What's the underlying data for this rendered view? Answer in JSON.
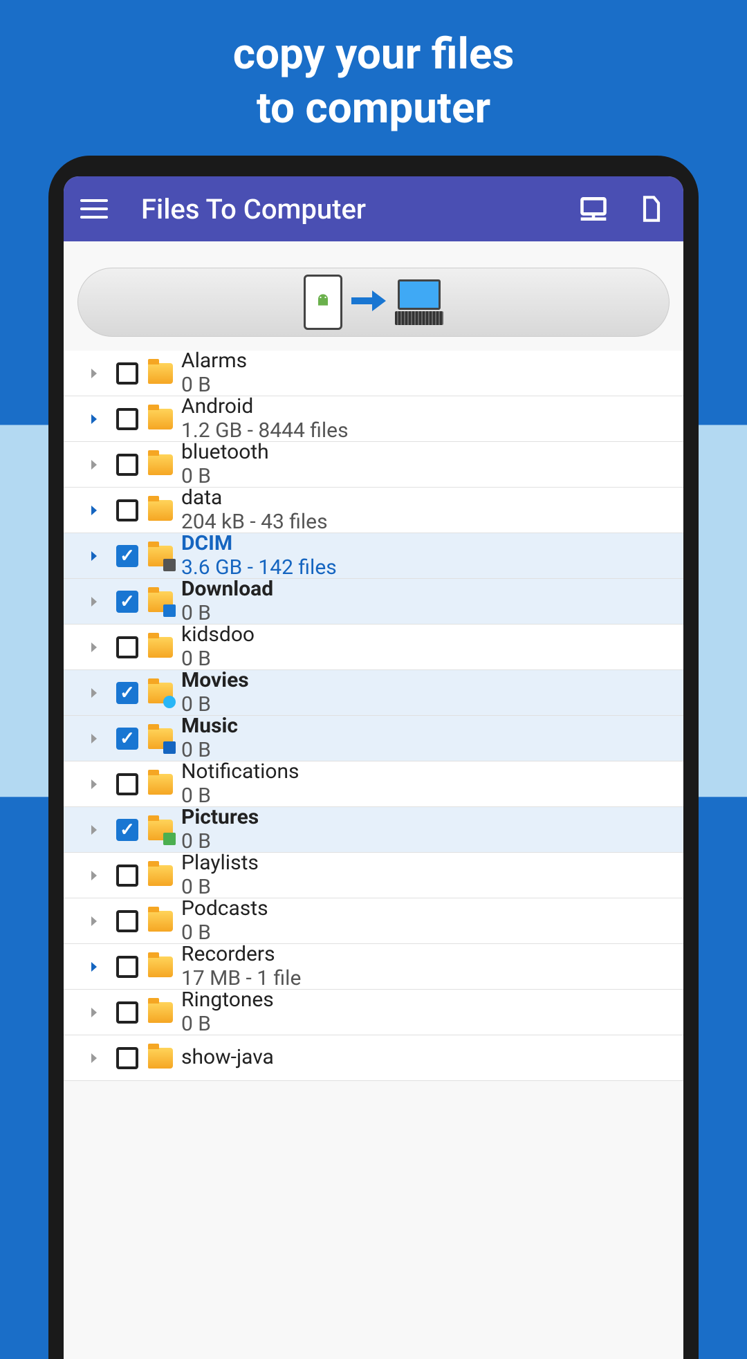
{
  "promo": {
    "line1": "copy your files",
    "line2": "to computer"
  },
  "appbar": {
    "title": "Files To Computer"
  },
  "items": [
    {
      "name": "Alarms",
      "sub": "0 B",
      "checked": false,
      "expandable": "gray",
      "icon": "plain",
      "bold": false,
      "active": false
    },
    {
      "name": "Android",
      "sub": "1.2 GB - 8444 files",
      "checked": false,
      "expandable": "blue",
      "icon": "plain",
      "bold": false,
      "active": false
    },
    {
      "name": "bluetooth",
      "sub": "0 B",
      "checked": false,
      "expandable": "gray",
      "icon": "plain",
      "bold": false,
      "active": false
    },
    {
      "name": "data",
      "sub": "204 kB - 43 files",
      "checked": false,
      "expandable": "blue",
      "icon": "plain",
      "bold": false,
      "active": false
    },
    {
      "name": "DCIM",
      "sub": "3.6 GB - 142 files",
      "checked": true,
      "expandable": "blue",
      "icon": "camera",
      "bold": true,
      "active": true
    },
    {
      "name": "Download",
      "sub": "0 B",
      "checked": true,
      "expandable": "gray",
      "icon": "down",
      "bold": true,
      "active": false
    },
    {
      "name": "kidsdoo",
      "sub": "0 B",
      "checked": false,
      "expandable": "gray",
      "icon": "plain",
      "bold": false,
      "active": false
    },
    {
      "name": "Movies",
      "sub": "0 B",
      "checked": true,
      "expandable": "gray",
      "icon": "play",
      "bold": true,
      "active": false
    },
    {
      "name": "Music",
      "sub": "0 B",
      "checked": true,
      "expandable": "gray",
      "icon": "note",
      "bold": true,
      "active": false
    },
    {
      "name": "Notifications",
      "sub": "0 B",
      "checked": false,
      "expandable": "gray",
      "icon": "plain",
      "bold": false,
      "active": false
    },
    {
      "name": "Pictures",
      "sub": "0 B",
      "checked": true,
      "expandable": "gray",
      "icon": "pic",
      "bold": true,
      "active": false
    },
    {
      "name": "Playlists",
      "sub": "0 B",
      "checked": false,
      "expandable": "gray",
      "icon": "plain",
      "bold": false,
      "active": false
    },
    {
      "name": "Podcasts",
      "sub": "0 B",
      "checked": false,
      "expandable": "gray",
      "icon": "plain",
      "bold": false,
      "active": false
    },
    {
      "name": "Recorders",
      "sub": "17 MB - 1 file",
      "checked": false,
      "expandable": "blue",
      "icon": "plain",
      "bold": false,
      "active": false
    },
    {
      "name": "Ringtones",
      "sub": "0 B",
      "checked": false,
      "expandable": "gray",
      "icon": "plain",
      "bold": false,
      "active": false
    },
    {
      "name": "show-java",
      "sub": "",
      "checked": false,
      "expandable": "gray",
      "icon": "plain",
      "bold": false,
      "active": false
    }
  ]
}
